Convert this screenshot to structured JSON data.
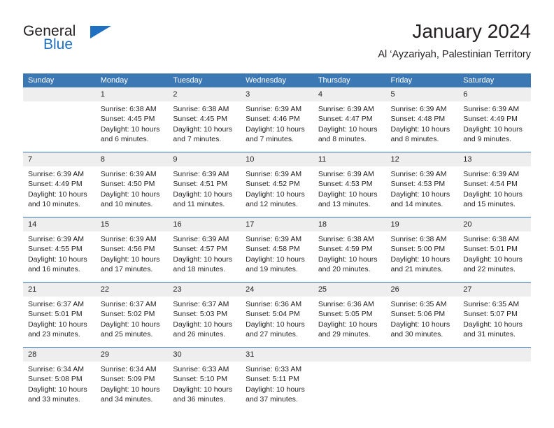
{
  "logo": {
    "word1": "General",
    "word2": "Blue",
    "triangle_icon": "blue-triangle-icon",
    "color_dark": "#231f20",
    "color_blue": "#1f70c1"
  },
  "header": {
    "title": "January 2024",
    "subtitle": "Al ‘Ayzariyah, Palestinian Territory"
  },
  "theme": {
    "header_blue": "#3c78b4",
    "daynum_gray": "#eeeeee",
    "text": "#231f20"
  },
  "weekday_headers": [
    "Sunday",
    "Monday",
    "Tuesday",
    "Wednesday",
    "Thursday",
    "Friday",
    "Saturday"
  ],
  "weeks": [
    [
      {
        "day": "",
        "empty": true,
        "lines": []
      },
      {
        "day": "1",
        "empty": false,
        "lines": [
          "Sunrise: 6:38 AM",
          "Sunset: 4:45 PM",
          "Daylight: 10 hours",
          "and 6 minutes."
        ]
      },
      {
        "day": "2",
        "empty": false,
        "lines": [
          "Sunrise: 6:38 AM",
          "Sunset: 4:45 PM",
          "Daylight: 10 hours",
          "and 7 minutes."
        ]
      },
      {
        "day": "3",
        "empty": false,
        "lines": [
          "Sunrise: 6:39 AM",
          "Sunset: 4:46 PM",
          "Daylight: 10 hours",
          "and 7 minutes."
        ]
      },
      {
        "day": "4",
        "empty": false,
        "lines": [
          "Sunrise: 6:39 AM",
          "Sunset: 4:47 PM",
          "Daylight: 10 hours",
          "and 8 minutes."
        ]
      },
      {
        "day": "5",
        "empty": false,
        "lines": [
          "Sunrise: 6:39 AM",
          "Sunset: 4:48 PM",
          "Daylight: 10 hours",
          "and 8 minutes."
        ]
      },
      {
        "day": "6",
        "empty": false,
        "lines": [
          "Sunrise: 6:39 AM",
          "Sunset: 4:49 PM",
          "Daylight: 10 hours",
          "and 9 minutes."
        ]
      }
    ],
    [
      {
        "day": "7",
        "empty": false,
        "lines": [
          "Sunrise: 6:39 AM",
          "Sunset: 4:49 PM",
          "Daylight: 10 hours",
          "and 10 minutes."
        ]
      },
      {
        "day": "8",
        "empty": false,
        "lines": [
          "Sunrise: 6:39 AM",
          "Sunset: 4:50 PM",
          "Daylight: 10 hours",
          "and 10 minutes."
        ]
      },
      {
        "day": "9",
        "empty": false,
        "lines": [
          "Sunrise: 6:39 AM",
          "Sunset: 4:51 PM",
          "Daylight: 10 hours",
          "and 11 minutes."
        ]
      },
      {
        "day": "10",
        "empty": false,
        "lines": [
          "Sunrise: 6:39 AM",
          "Sunset: 4:52 PM",
          "Daylight: 10 hours",
          "and 12 minutes."
        ]
      },
      {
        "day": "11",
        "empty": false,
        "lines": [
          "Sunrise: 6:39 AM",
          "Sunset: 4:53 PM",
          "Daylight: 10 hours",
          "and 13 minutes."
        ]
      },
      {
        "day": "12",
        "empty": false,
        "lines": [
          "Sunrise: 6:39 AM",
          "Sunset: 4:53 PM",
          "Daylight: 10 hours",
          "and 14 minutes."
        ]
      },
      {
        "day": "13",
        "empty": false,
        "lines": [
          "Sunrise: 6:39 AM",
          "Sunset: 4:54 PM",
          "Daylight: 10 hours",
          "and 15 minutes."
        ]
      }
    ],
    [
      {
        "day": "14",
        "empty": false,
        "lines": [
          "Sunrise: 6:39 AM",
          "Sunset: 4:55 PM",
          "Daylight: 10 hours",
          "and 16 minutes."
        ]
      },
      {
        "day": "15",
        "empty": false,
        "lines": [
          "Sunrise: 6:39 AM",
          "Sunset: 4:56 PM",
          "Daylight: 10 hours",
          "and 17 minutes."
        ]
      },
      {
        "day": "16",
        "empty": false,
        "lines": [
          "Sunrise: 6:39 AM",
          "Sunset: 4:57 PM",
          "Daylight: 10 hours",
          "and 18 minutes."
        ]
      },
      {
        "day": "17",
        "empty": false,
        "lines": [
          "Sunrise: 6:39 AM",
          "Sunset: 4:58 PM",
          "Daylight: 10 hours",
          "and 19 minutes."
        ]
      },
      {
        "day": "18",
        "empty": false,
        "lines": [
          "Sunrise: 6:38 AM",
          "Sunset: 4:59 PM",
          "Daylight: 10 hours",
          "and 20 minutes."
        ]
      },
      {
        "day": "19",
        "empty": false,
        "lines": [
          "Sunrise: 6:38 AM",
          "Sunset: 5:00 PM",
          "Daylight: 10 hours",
          "and 21 minutes."
        ]
      },
      {
        "day": "20",
        "empty": false,
        "lines": [
          "Sunrise: 6:38 AM",
          "Sunset: 5:01 PM",
          "Daylight: 10 hours",
          "and 22 minutes."
        ]
      }
    ],
    [
      {
        "day": "21",
        "empty": false,
        "lines": [
          "Sunrise: 6:37 AM",
          "Sunset: 5:01 PM",
          "Daylight: 10 hours",
          "and 23 minutes."
        ]
      },
      {
        "day": "22",
        "empty": false,
        "lines": [
          "Sunrise: 6:37 AM",
          "Sunset: 5:02 PM",
          "Daylight: 10 hours",
          "and 25 minutes."
        ]
      },
      {
        "day": "23",
        "empty": false,
        "lines": [
          "Sunrise: 6:37 AM",
          "Sunset: 5:03 PM",
          "Daylight: 10 hours",
          "and 26 minutes."
        ]
      },
      {
        "day": "24",
        "empty": false,
        "lines": [
          "Sunrise: 6:36 AM",
          "Sunset: 5:04 PM",
          "Daylight: 10 hours",
          "and 27 minutes."
        ]
      },
      {
        "day": "25",
        "empty": false,
        "lines": [
          "Sunrise: 6:36 AM",
          "Sunset: 5:05 PM",
          "Daylight: 10 hours",
          "and 29 minutes."
        ]
      },
      {
        "day": "26",
        "empty": false,
        "lines": [
          "Sunrise: 6:35 AM",
          "Sunset: 5:06 PM",
          "Daylight: 10 hours",
          "and 30 minutes."
        ]
      },
      {
        "day": "27",
        "empty": false,
        "lines": [
          "Sunrise: 6:35 AM",
          "Sunset: 5:07 PM",
          "Daylight: 10 hours",
          "and 31 minutes."
        ]
      }
    ],
    [
      {
        "day": "28",
        "empty": false,
        "lines": [
          "Sunrise: 6:34 AM",
          "Sunset: 5:08 PM",
          "Daylight: 10 hours",
          "and 33 minutes."
        ]
      },
      {
        "day": "29",
        "empty": false,
        "lines": [
          "Sunrise: 6:34 AM",
          "Sunset: 5:09 PM",
          "Daylight: 10 hours",
          "and 34 minutes."
        ]
      },
      {
        "day": "30",
        "empty": false,
        "lines": [
          "Sunrise: 6:33 AM",
          "Sunset: 5:10 PM",
          "Daylight: 10 hours",
          "and 36 minutes."
        ]
      },
      {
        "day": "31",
        "empty": false,
        "lines": [
          "Sunrise: 6:33 AM",
          "Sunset: 5:11 PM",
          "Daylight: 10 hours",
          "and 37 minutes."
        ]
      },
      {
        "day": "",
        "empty": true,
        "lines": []
      },
      {
        "day": "",
        "empty": true,
        "lines": []
      },
      {
        "day": "",
        "empty": true,
        "lines": []
      }
    ]
  ]
}
